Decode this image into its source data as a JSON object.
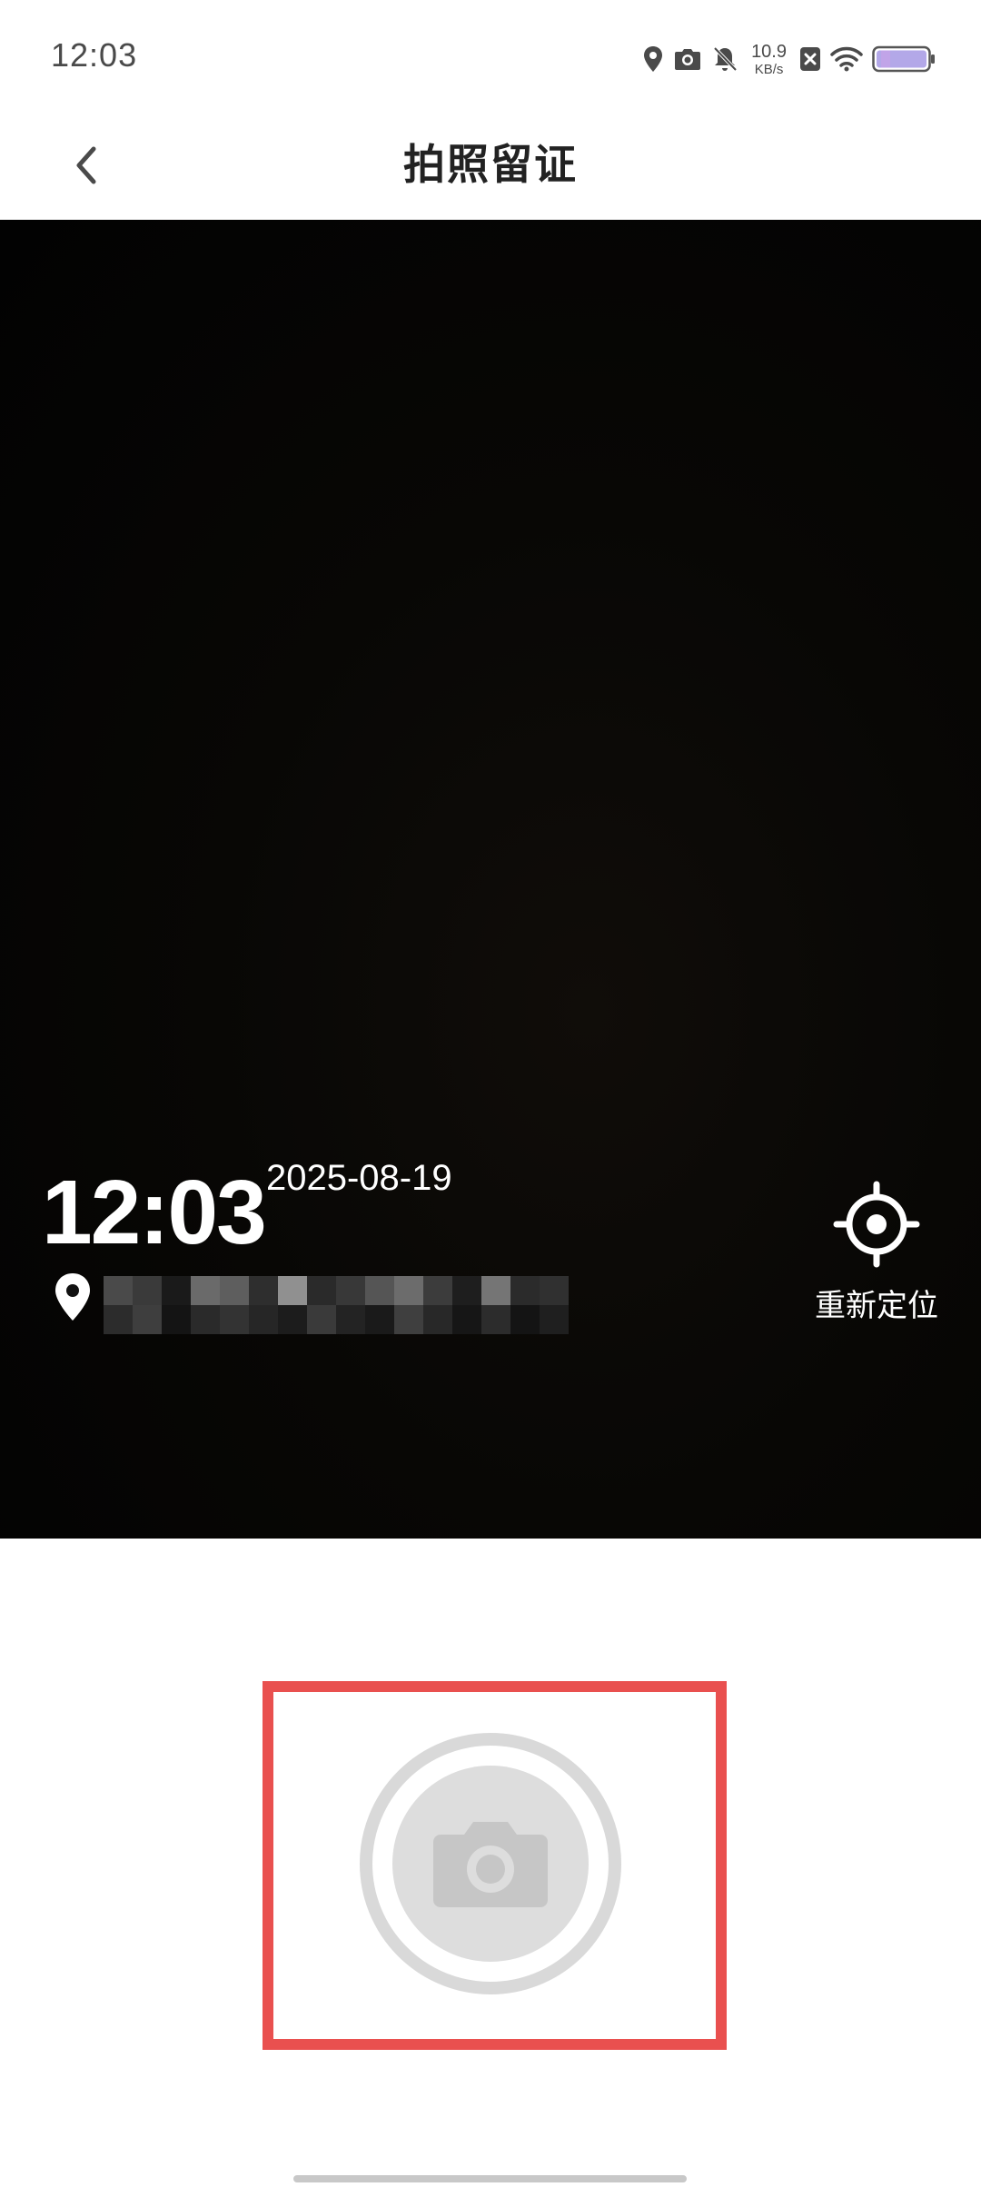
{
  "status_bar": {
    "time": "12:03",
    "net_speed_value": "10.9",
    "net_speed_unit": "KB/s",
    "icons": [
      "location-icon",
      "camera-status-icon",
      "bell-off-icon",
      "sim-x-icon",
      "wifi-icon",
      "battery-icon"
    ],
    "battery_color": "#b3a8e8"
  },
  "header": {
    "title": "拍照留证",
    "back_icon": "chevron-left-icon"
  },
  "preview": {
    "watermark_time": "12:03",
    "watermark_date": "2025-08-19",
    "relocate_label": "重新定位",
    "relocate_icon": "locate-target-icon",
    "location_icon": "map-pin-icon"
  },
  "actions": {
    "shutter_icon": "camera-icon",
    "highlight_color": "#e9504f"
  }
}
